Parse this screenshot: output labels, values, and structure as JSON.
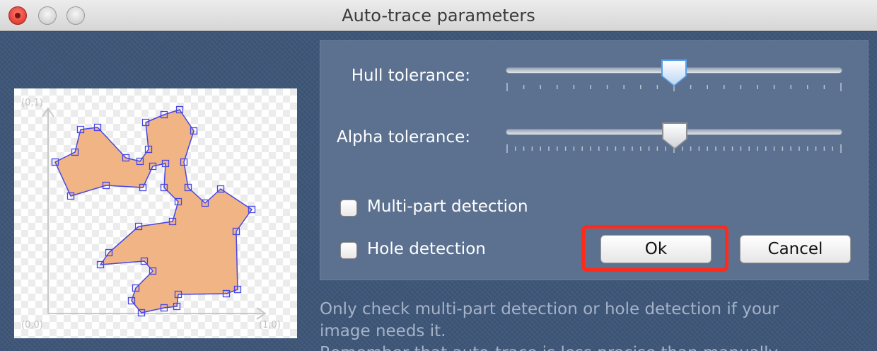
{
  "window": {
    "title": "Auto-trace parameters",
    "close_icon": "close-icon",
    "minimize_icon": "minimize-icon",
    "zoom_icon": "zoom-icon"
  },
  "preview": {
    "labels": {
      "origin": "(0,0)",
      "top_left": "(0,1)",
      "bottom_right": "(1,0)"
    },
    "colors": {
      "fill": "#f0b485",
      "outline": "#4646e6"
    }
  },
  "settings": {
    "hull_tolerance": {
      "label": "Hull tolerance:",
      "value": 0.5,
      "ticks": 21
    },
    "alpha_tolerance": {
      "label": "Alpha tolerance:",
      "value": 0.5,
      "ticks": 41
    },
    "multipart": {
      "label": "Multi-part detection",
      "checked": false
    },
    "hole": {
      "label": "Hole detection",
      "checked": false
    },
    "ok_label": "Ok",
    "cancel_label": "Cancel"
  },
  "info": {
    "line1": "Only check multi-part detection or hole detection if your",
    "line2": "image needs it.",
    "line3": "Remember that auto-trace is less precise than manually"
  },
  "highlight_color": "#ff2a1a"
}
